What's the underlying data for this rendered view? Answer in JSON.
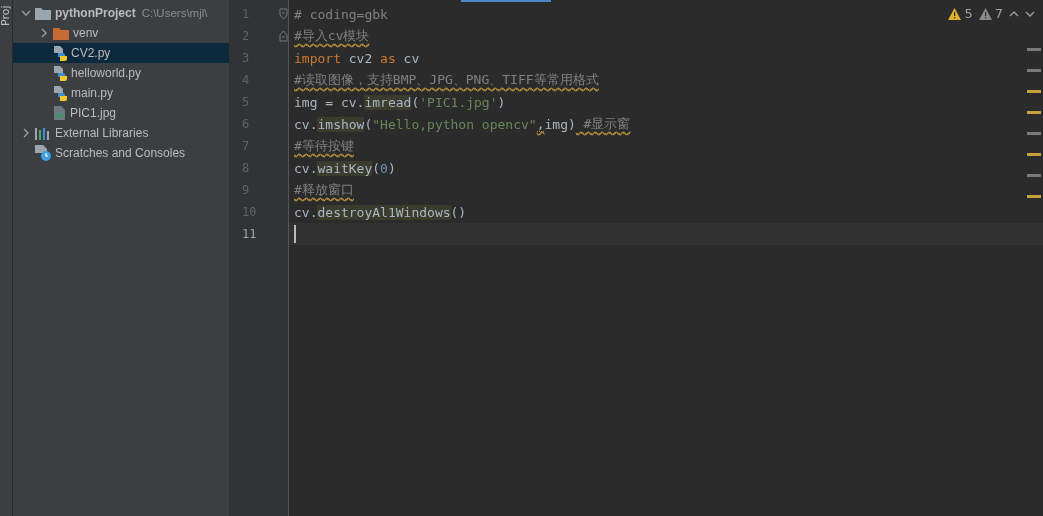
{
  "tool_strip": {
    "label": "Proj"
  },
  "project_tree": [
    {
      "label": "pythonProject",
      "path": "C:\\Users\\mjl\\",
      "kind": "folder",
      "expanded": true,
      "selected": false,
      "children": [
        {
          "label": "venv",
          "kind": "venv-folder",
          "expanded": false,
          "selected": false
        },
        {
          "label": "CV2.py",
          "kind": "python",
          "selected": true
        },
        {
          "label": "helloworld.py",
          "kind": "python",
          "selected": false
        },
        {
          "label": "main.py",
          "kind": "python",
          "selected": false
        },
        {
          "label": "PIC1.jpg",
          "kind": "image",
          "selected": false
        }
      ]
    },
    {
      "label": "External Libraries",
      "kind": "libraries",
      "expanded": false,
      "selected": false
    },
    {
      "label": "Scratches and Consoles",
      "kind": "scratches",
      "selected": false
    }
  ],
  "editor": {
    "inspections": [
      {
        "kind": "warning",
        "count": "5"
      },
      {
        "kind": "weak-warning",
        "count": "7"
      }
    ],
    "lines": [
      {
        "number": "1",
        "current": false,
        "kind": "fold-start",
        "tokens": [
          {
            "kind": "comment",
            "text": "# coding=gbk"
          }
        ]
      },
      {
        "number": "2",
        "current": false,
        "kind": "fold-end",
        "tokens": [
          {
            "kind": "comment",
            "text": "#导入cv模块",
            "warned": true
          }
        ]
      },
      {
        "number": "3",
        "current": false,
        "kind": "plain",
        "tokens": [
          {
            "kind": "keyword",
            "text": "import"
          },
          {
            "kind": "text",
            "text": " cv2 "
          },
          {
            "kind": "keyword",
            "text": "as"
          },
          {
            "kind": "text",
            "text": " cv"
          }
        ]
      },
      {
        "number": "4",
        "current": false,
        "kind": "plain",
        "tokens": [
          {
            "kind": "comment",
            "text": "#读取图像，支持BMP、JPG、PNG、TIFF等常用格式",
            "warned": true
          }
        ]
      },
      {
        "number": "5",
        "current": false,
        "kind": "plain",
        "tokens": [
          {
            "kind": "text",
            "text": "img = cv."
          },
          {
            "kind": "call",
            "text": "imread"
          },
          {
            "kind": "text",
            "text": "("
          },
          {
            "kind": "string",
            "text": "'PIC1.jpg'"
          },
          {
            "kind": "text",
            "text": ")"
          }
        ]
      },
      {
        "number": "6",
        "current": false,
        "kind": "plain",
        "tokens": [
          {
            "kind": "text",
            "text": "cv."
          },
          {
            "kind": "call",
            "text": "imshow"
          },
          {
            "kind": "text",
            "text": "("
          },
          {
            "kind": "string",
            "text": "\"Hello,python opencv\""
          },
          {
            "kind": "text",
            "text": ",",
            "warned": true
          },
          {
            "kind": "text",
            "text": "img)"
          },
          {
            "kind": "comment",
            "text": " #显示窗",
            "warned": true
          }
        ]
      },
      {
        "number": "7",
        "current": false,
        "kind": "plain",
        "tokens": [
          {
            "kind": "comment",
            "text": "#等待按键",
            "warned": true
          }
        ]
      },
      {
        "number": "8",
        "current": false,
        "kind": "plain",
        "tokens": [
          {
            "kind": "text",
            "text": "cv."
          },
          {
            "kind": "call",
            "text": "waitKey"
          },
          {
            "kind": "text",
            "text": "("
          },
          {
            "kind": "number",
            "text": "0"
          },
          {
            "kind": "text",
            "text": ")"
          }
        ]
      },
      {
        "number": "9",
        "current": false,
        "kind": "plain",
        "tokens": [
          {
            "kind": "comment",
            "text": "#释放窗口",
            "warned": true
          }
        ]
      },
      {
        "number": "10",
        "current": false,
        "kind": "plain",
        "tokens": [
          {
            "kind": "text",
            "text": "cv."
          },
          {
            "kind": "call",
            "text": "destroyAl1Windows"
          },
          {
            "kind": "text",
            "text": "()"
          }
        ]
      },
      {
        "number": "11",
        "current": true,
        "kind": "plain"
      }
    ],
    "stripe_marks": [
      {
        "color": "#7a7a7a"
      },
      {
        "color": "#7a7a7a"
      },
      {
        "color": "#c9a13a"
      },
      {
        "color": "#c9a13a"
      },
      {
        "color": "#7a7a7a"
      },
      {
        "color": "#c9a13a"
      },
      {
        "color": "#7a7a7a"
      },
      {
        "color": "#c9a13a"
      }
    ]
  }
}
